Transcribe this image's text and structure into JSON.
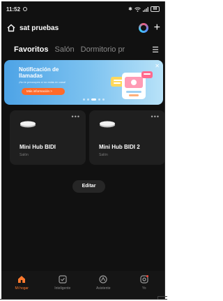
{
  "status_bar": {
    "time": "11:52",
    "battery": "88"
  },
  "header": {
    "home_name": "sat pruebas"
  },
  "tabs": [
    {
      "label": "Favoritos"
    },
    {
      "label": "Salón"
    },
    {
      "label": "Dormitorio pr"
    }
  ],
  "banner": {
    "title": "Notificación de llamadas",
    "subtitle": "¡No te preocupes si no estás en casa!",
    "button_label": "Más información >",
    "page_count": 5,
    "active_page": 3
  },
  "devices": [
    {
      "name": "Mini Hub BIDI",
      "room": "Salón"
    },
    {
      "name": "Mini Hub BIDI 2",
      "room": "Salón"
    }
  ],
  "edit_label": "Editar",
  "nav": [
    {
      "label": "Mi hogar",
      "icon": "home-icon",
      "active": true
    },
    {
      "label": "Inteligente",
      "icon": "checkbox-icon",
      "active": false
    },
    {
      "label": "Asistente",
      "icon": "assistant-icon",
      "active": false
    },
    {
      "label": "Yo",
      "icon": "profile-icon",
      "active": false
    }
  ],
  "colors": {
    "accent": "#ff7a2e",
    "background": "#111111",
    "card": "#1f1f1f",
    "banner": "#4da3e6"
  }
}
